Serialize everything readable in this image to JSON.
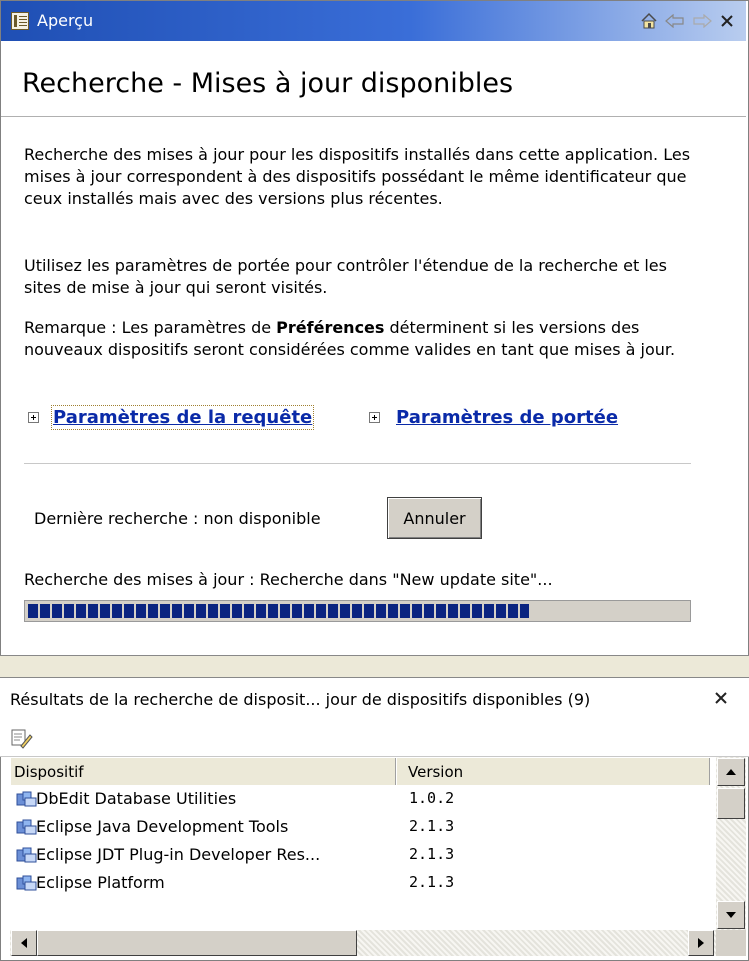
{
  "overview_view": {
    "title": "Aperçu",
    "page_title": "Recherche - Mises à jour disponibles",
    "paragraph1": "Recherche des mises à jour pour les dispositifs installés dans cette application. Les mises à jour correspondent à des dispositifs possédant le même identificateur que ceux installés mais avec des versions plus récentes.",
    "paragraph2": "Utilisez les paramètres de portée pour contrôler l'étendue de la recherche et les sites de mise à jour qui seront visités.",
    "note_prefix": "Remarque : Les paramètres de ",
    "note_bold": "Préférences",
    "note_suffix": " déterminent si les versions des nouveaux dispositifs seront considérées comme valides en tant que mises à jour.",
    "section_links": {
      "query": "Paramètres de la requête",
      "scope": "Paramètres de portée"
    },
    "last_search": "Dernière recherche : non disponible",
    "cancel_label": "Annuler",
    "progress_label": "Recherche des mises à jour : Recherche dans \"New update site\"...",
    "progress_fraction": 0.76
  },
  "results_view": {
    "title": "Résultats de la recherche de disposit... jour de dispositifs disponibles (9)",
    "columns": [
      "Dispositif",
      "Version"
    ],
    "rows": [
      {
        "name": "DbEdit Database Utilities",
        "version": "1.0.2"
      },
      {
        "name": "Eclipse Java Development Tools",
        "version": "2.1.3"
      },
      {
        "name": "Eclipse JDT Plug-in Developer Res...",
        "version": "2.1.3"
      },
      {
        "name": "Eclipse Platform",
        "version": "2.1.3"
      }
    ]
  }
}
